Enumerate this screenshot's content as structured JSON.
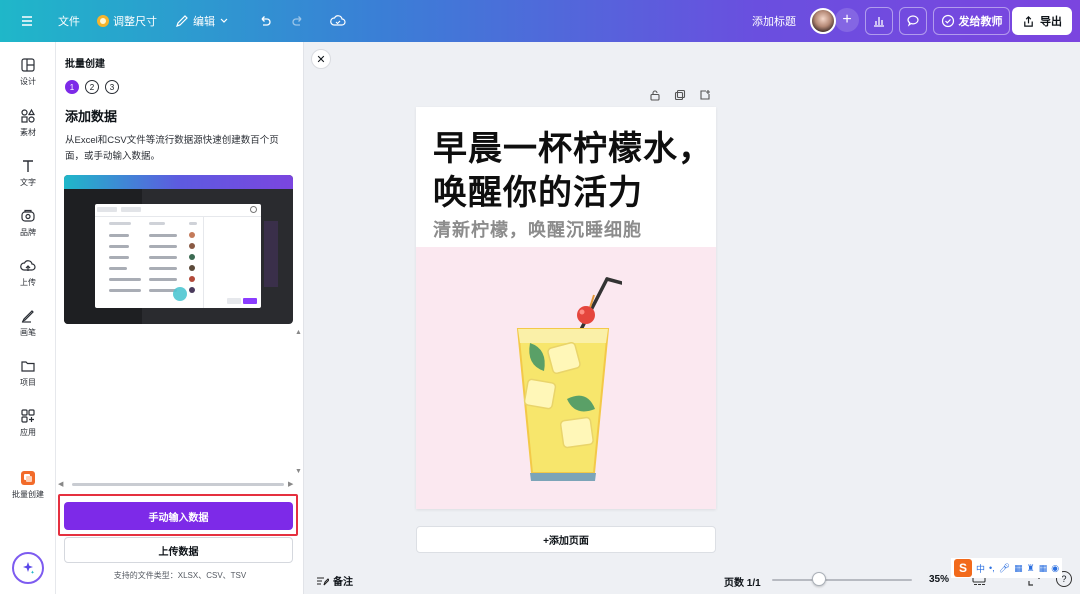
{
  "topbar": {
    "file_label": "文件",
    "resize_label": "调整尺寸",
    "edit_label": "编辑",
    "add_title_label": "添加标题",
    "send_teacher_label": "发给教师",
    "export_label": "导出"
  },
  "rail": {
    "items": [
      {
        "label": "设计"
      },
      {
        "label": "素材"
      },
      {
        "label": "文字"
      },
      {
        "label": "品牌"
      },
      {
        "label": "上传"
      },
      {
        "label": "画笔"
      },
      {
        "label": "项目"
      },
      {
        "label": "应用"
      },
      {
        "label": "批量创建"
      }
    ]
  },
  "panel": {
    "title": "批量创建",
    "steps": [
      "1",
      "2",
      "3"
    ],
    "heading": "添加数据",
    "description": "从Excel和CSV文件等流行数据源快速创建数百个页面，或手动输入数据。",
    "manual_button": "手动输入数据",
    "upload_button": "上传数据",
    "file_types": "支持的文件类型：XLSX、CSV、TSV"
  },
  "canvas": {
    "headline": "早晨一杯柠檬水，唤醒你的活力",
    "subline": "清新柠檬，唤醒沉睡细胞",
    "add_page_label": "+添加页面"
  },
  "bottombar": {
    "notes_label": "备注",
    "pages_label": "页数 1/1",
    "zoom_label": "35%",
    "zoom_fraction": 0.35,
    "help_label": "?"
  },
  "ime": {
    "logo": "S",
    "mode": "中"
  },
  "colors": {
    "primary": "#7d2ae8",
    "highlight": "#e5303f",
    "page_pink": "#fbe8f0"
  }
}
